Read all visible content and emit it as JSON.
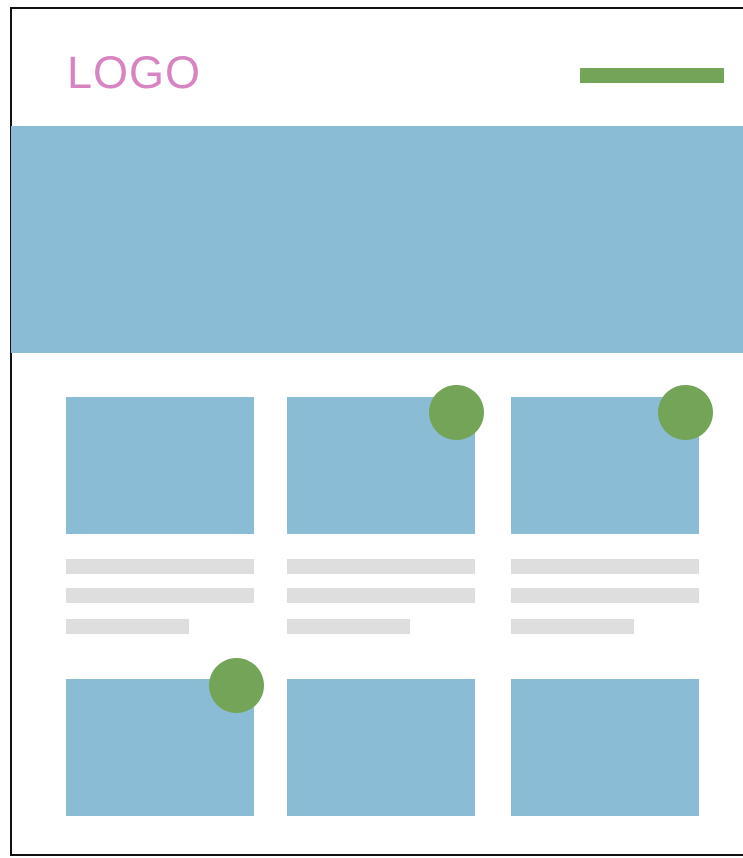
{
  "colors": {
    "logo": "#d884c2",
    "accent": "#73a457",
    "image_placeholder": "#8bbcd6",
    "text_placeholder": "#dededf",
    "border": "#111111"
  },
  "header": {
    "logo_text": "LOGO"
  },
  "cards": [
    {
      "row": 1,
      "col": 1,
      "has_badge": false,
      "has_text_lines": true
    },
    {
      "row": 1,
      "col": 2,
      "has_badge": true,
      "has_text_lines": true
    },
    {
      "row": 1,
      "col": 3,
      "has_badge": true,
      "has_text_lines": true
    },
    {
      "row": 2,
      "col": 1,
      "has_badge": true,
      "has_text_lines": false
    },
    {
      "row": 2,
      "col": 2,
      "has_badge": false,
      "has_text_lines": false
    },
    {
      "row": 2,
      "col": 3,
      "has_badge": false,
      "has_text_lines": false
    }
  ]
}
